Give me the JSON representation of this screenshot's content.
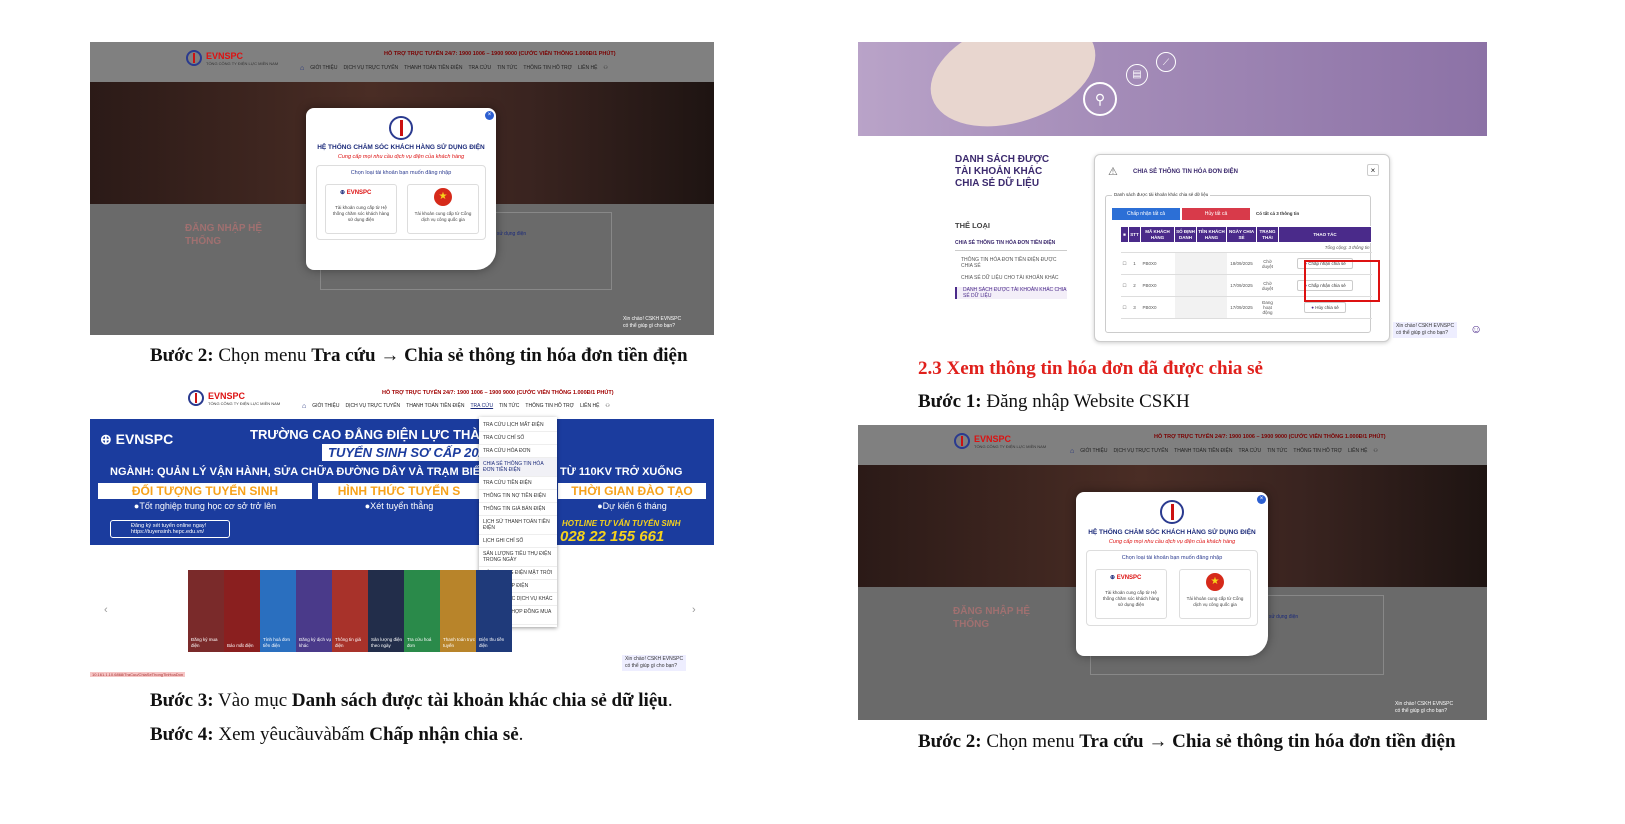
{
  "site": {
    "brand": "EVNSPC",
    "brand_sub": "TỔNG CÔNG TY ĐIỆN LỰC MIỀN NAM",
    "hotline": "HỖ TRỢ TRỰC TUYẾN 24/7: 1900 1006 – 1900 9000 (CƯỚC VIỄN THÔNG 1.000Đ/1 PHÚT)",
    "nav": [
      "GIỚI THIỆU",
      "DỊCH VỤ TRỰC TUYẾN",
      "THANH TOÁN TIỀN ĐIỆN",
      "TRA CỨU",
      "TIN TỨC",
      "THÔNG TIN HỖ TRỢ",
      "LIÊN HỆ"
    ],
    "chat_line1": "Xin chào! CSKH EVNSPC",
    "chat_line2": "có thể giúp gì cho bạn?",
    "login_dim": "ĐĂNG NHẬP HỆ THỐNG",
    "login_hint": "ng sử dụng điện"
  },
  "login_modal": {
    "title": "HỆ THỐNG CHĂM SÓC KHÁCH HÀNG SỬ DỤNG ĐIỆN",
    "subtitle": "Cung cấp mọi nhu cầu dịch vụ điện của khách hàng",
    "pick_label": "Chọn loại tài khoản bạn muốn đăng nhập",
    "card1": "Tài khoản cung cấp từ Hệ thống chăm sóc khách hàng sử dụng điện",
    "card2": "Tài khoản cung cấp từ Cổng dịch vụ công quốc gia",
    "close": "×"
  },
  "captions": {
    "step2_label": "Bước 2:",
    "step2_text": " Chọn menu ",
    "step2_menu": "Tra cứu → Chia sẻ thông tin hóa đơn tiền điện",
    "step3_label": "Bước 3:",
    "step3_text": " Vào mục ",
    "step3_item": "Danh sách được tài khoản khác chia sẻ dữ liệu",
    "step3_end": ".",
    "step4_label": "Bước 4:",
    "step4_text": " Xem yêucầuvàbấm ",
    "step4_action": "Chấp nhận chia sẻ",
    "step4_end": ".",
    "section_23": "2.3 Xem thông tin hóa đơn đã được chia sẻ",
    "step1_label": "Bước 1:",
    "step1_text": " Đăng nhập Website CSKH"
  },
  "banner": {
    "title": "TRƯỜNG CAO ĐẲNG ĐIỆN LỰC THÀNH PHỐ",
    "program": "TUYỂN SINH SƠ CẤP 2025",
    "major": "NGÀNH: QUẢN LÝ VẬN HÀNH, SỬA CHỮA ĐƯỜNG DÂY VÀ TRẠM BIẾN",
    "major_end": "TỪ 110KV TRỞ XUỐNG",
    "col1_head": "ĐỐI TƯỢNG TUYỂN SINH",
    "col1_val": "●Tốt nghiệp trung học cơ sở trở lên",
    "col2_head": "HÌNH THỨC TUYỂN S",
    "col2_val": "●Xét tuyển thẳng",
    "col3_head": "THỜI GIAN ĐÀO TẠO",
    "col3_val": "●Dự kiến 6 tháng",
    "register": "Đăng ký xét tuyển online ngay!",
    "register_url": "https://tuyensinh.hepc.edu.vn/",
    "hotline_label": "HOTLINE TƯ VẤN TUYỂN SINH",
    "hotline_num": "028 22 155 661"
  },
  "tra_cuu_menu": [
    "TRA CỨU LỊCH MẤT ĐIỆN",
    "TRA CỨU CHỈ SỐ",
    "TRA CỨU HÓA ĐƠN",
    "CHIA SẺ THÔNG TIN HÓA ĐƠN TIỀN ĐIỆN",
    "TRA CỨU TIỀN ĐIỆN",
    "THÔNG TIN NỢ TIỀN ĐIỆN",
    "THÔNG TIN GIÁ BÁN ĐIỆN",
    "LỊCH SỬ THANH TOÁN TIỀN ĐIỆN",
    "LỊCH GHI CHỈ SỐ",
    "SẢN LƯỢNG TIÊU THỤ ĐIỆN TRONG NGÀY",
    "SẢN LƯỢNG ĐIỆN MẶT TRỜI",
    "TIẾN ĐỘ CẤP ĐIỆN",
    "TIẾN ĐỘ CÁC DỊCH VỤ KHÁC",
    "XEM VÀ KÝ HỢP ĐỒNG MUA BÁN ĐIỆN"
  ],
  "tiles": [
    {
      "label": "Đăng ký mua điện",
      "color": "#7a2a2a"
    },
    {
      "label": "Báo mất điện",
      "color": "#8a1f1f"
    },
    {
      "label": "Tính hoá đơn tiền điện",
      "color": "#2a6fbf"
    },
    {
      "label": "Đăng ký dịch vụ khác",
      "color": "#4a3a8a"
    },
    {
      "label": "Thông tin giá điện",
      "color": "#a8322a"
    },
    {
      "label": "Sản lượng điện theo ngày",
      "color": "#222d4a"
    },
    {
      "label": "Tra cứu hoá đơn",
      "color": "#2a8a4a"
    },
    {
      "label": "Thanh toán trực tuyến",
      "color": "#b8842a"
    },
    {
      "label": "Điện thu tiền điện",
      "color": "#1f3a7a"
    }
  ],
  "status_url": "10.161.1.10.6868/TraCuu/ChiaSeThongTinHoaDon",
  "share_page": {
    "side_title": "DANH SÁCH ĐƯỢC TÀI KHOẢN KHÁC CHIA SẺ DỮ LIỆU",
    "category": "THỂ LOẠI",
    "cat_group": "CHIA SẺ THÔNG TIN HÓA ĐƠN TIỀN ĐIỆN",
    "items": [
      "THÔNG TIN HÓA ĐƠN TIỀN ĐIỆN ĐƯỢC CHIA SẺ",
      "CHIA SẺ DỮ LIỆU CHO TÀI KHOẢN KHÁC",
      "DANH SÁCH ĐƯỢC TÀI KHOẢN KHÁC CHIA SẺ DỮ LIỆU"
    ],
    "dialog_title": "CHIA SẺ THÔNG TIN HÓA ĐƠN ĐIỆN",
    "group_label": "Danh sách được tài khoản khác chia sẻ dữ liệu",
    "accept_all": "Chấp nhận tất cả",
    "cancel_all": "Hủy tất cả",
    "count_note": "Có tất cả 3 thông tin",
    "total_note": "Tổng cộng: 3 thông tin",
    "columns": [
      "",
      "STT",
      "MÃ KHÁCH HÀNG",
      "SỐ ĐỊNH DANH",
      "TÊN KHÁCH HÀNG",
      "NGÀY CHIA SẺ",
      "TRẠNG THÁI",
      "THAO TÁC"
    ],
    "rows": [
      {
        "stt": "1",
        "ma": "PB0X0",
        "ngay": "18/09/2025",
        "tt": "Chờ duyệt",
        "action": "Chấp nhận chia sẻ"
      },
      {
        "stt": "2",
        "ma": "PB0X0",
        "ngay": "17/09/2025",
        "tt": "Chờ duyệt",
        "action": "Chấp nhận chia sẻ"
      },
      {
        "stt": "3",
        "ma": "PB0X0",
        "ngay": "17/09/2025",
        "tt": "Đang hoạt động",
        "action": "Hủy chia sẻ"
      }
    ]
  },
  "colors": {
    "brand_blue": "#1b2a7a",
    "accent_red": "#e0201c",
    "purple": "#4a2a8a"
  }
}
